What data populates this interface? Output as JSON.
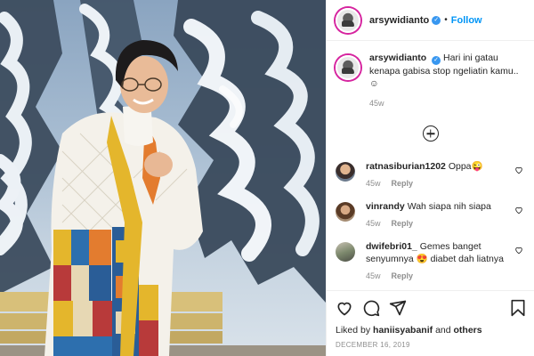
{
  "post": {
    "username": "arsywidianto",
    "follow_label": "Follow",
    "separator": "•",
    "caption": "Hari ini gatau kenapa gabisa stop ngeliatin kamu.. ☺",
    "caption_age": "45w"
  },
  "comments": [
    {
      "username": "ratnasiburian1202",
      "text": "Oppa😜",
      "age": "45w",
      "reply_label": "Reply"
    },
    {
      "username": "vinrandy",
      "text": "Wah siapa nih siapa",
      "age": "45w",
      "reply_label": "Reply"
    },
    {
      "username": "dwifebri01_",
      "text_before": "Gemes banget senyumnya",
      "emoji": "😍",
      "text_after": "diabet dah liatnya",
      "age": "45w",
      "reply_label": "Reply"
    }
  ],
  "footer": {
    "liked_by_prefix": "Liked by",
    "liked_by_user": "haniisyabanif",
    "liked_by_connector": "and",
    "liked_by_others": "others",
    "date": "DECEMBER 16, 2019"
  },
  "icons": {
    "like": "heart-icon",
    "comment": "comment-icon",
    "share": "paper-plane-icon",
    "save": "bookmark-icon",
    "more_comments": "plus-circle-icon",
    "verified": "verified-badge-icon"
  },
  "colors": {
    "accent": "#0095f6",
    "verified": "#3897f0",
    "muted": "#8e8e8e",
    "text": "#262626"
  }
}
